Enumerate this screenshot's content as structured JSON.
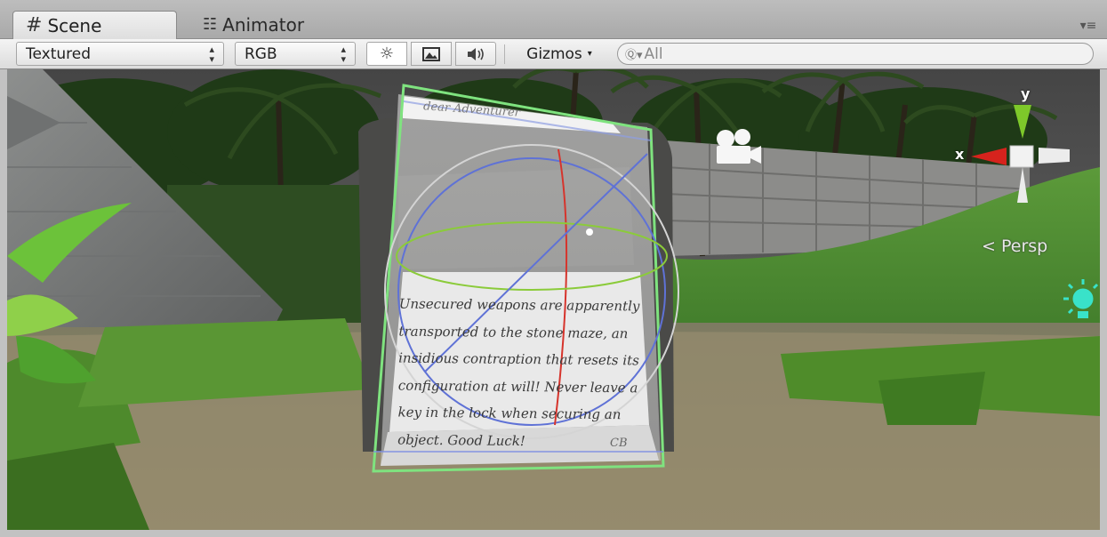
{
  "tabs": [
    {
      "label": "Scene",
      "icon": "grid-hash-icon",
      "active": true
    },
    {
      "label": "Animator",
      "icon": "animator-nodes-icon",
      "active": false
    }
  ],
  "toolbar": {
    "render_mode": "Textured",
    "color_channel": "RGB",
    "lighting_icon": "sun-icon",
    "image_icon": "image-icon",
    "audio_icon": "speaker-icon",
    "gizmos_label": "Gizmos",
    "search_value": "All"
  },
  "scene_gizmo": {
    "y_axis_label": "y",
    "x_axis_label": "x",
    "projection_label": "Persp",
    "y_color": "#7ec82a",
    "x_color": "#d6231d"
  },
  "note": {
    "heading": "dear Adventurer",
    "body": "Unsecured weapons are apparently transported to the stone maze, an insidious contraption that resets its configuration at will! Never leave a key in the lock when securing an object. Good Luck!",
    "signature": "CB"
  },
  "colors": {
    "selection_outline": "#7fe37f",
    "light_icon": "#39e2c9"
  }
}
